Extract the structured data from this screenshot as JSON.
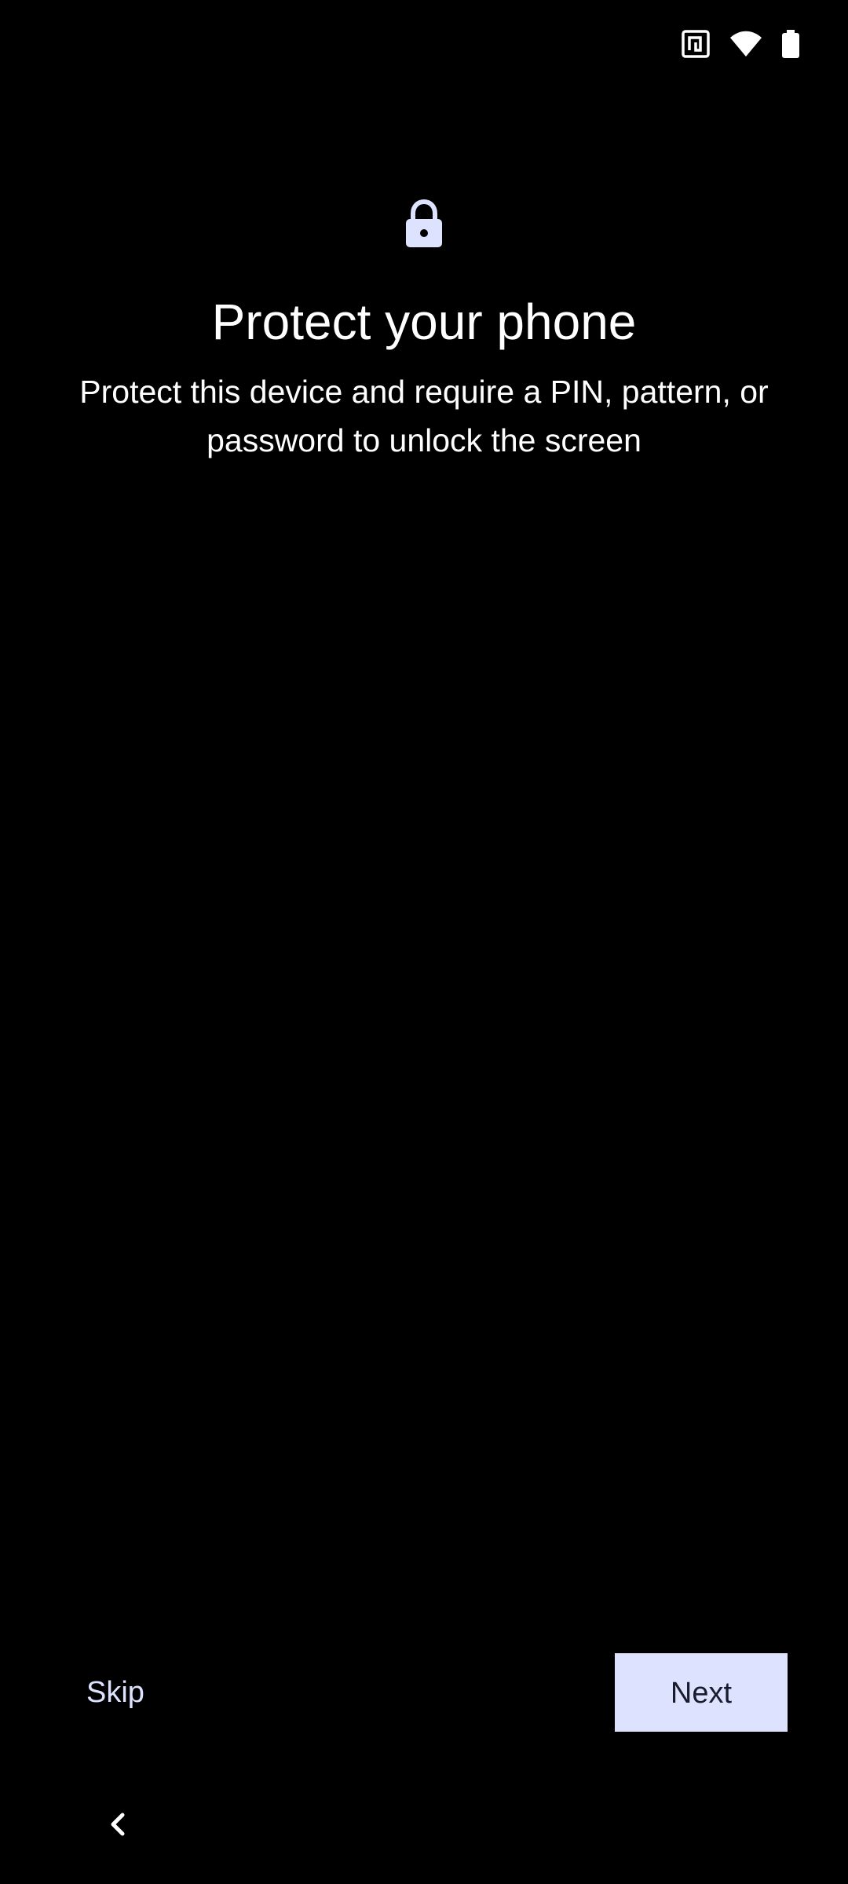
{
  "status_bar": {
    "icons": [
      "nfc-icon",
      "wifi-icon",
      "battery-icon"
    ]
  },
  "header": {
    "icon": "lock-icon",
    "title": "Protect your phone",
    "description": "Protect this device and require a PIN, pattern, or password to unlock the screen"
  },
  "actions": {
    "skip_label": "Skip",
    "next_label": "Next"
  },
  "nav_bar": {
    "back_icon": "chevron-left-icon"
  },
  "colors": {
    "background": "#000000",
    "accent": "#dde3ff",
    "button_text": "#1a1c2e",
    "text": "#ffffff"
  }
}
